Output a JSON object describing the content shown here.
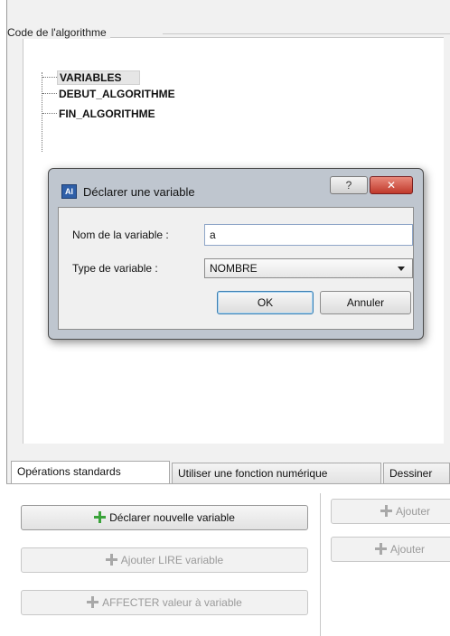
{
  "code_group": {
    "legend": "Code de l'algorithme",
    "tree": [
      "VARIABLES",
      "DEBUT_ALGORITHME",
      "FIN_ALGORITHME"
    ]
  },
  "dialog": {
    "title": "Déclarer une variable",
    "icon_text": "AI",
    "help_glyph": "?",
    "close_glyph": "✕",
    "name_label": "Nom de la variable :",
    "name_value": "a",
    "type_label": "Type de variable :",
    "type_value": "NOMBRE",
    "ok_label": "OK",
    "cancel_label": "Annuler"
  },
  "tabs": [
    {
      "label": "Opérations standards",
      "active": true
    },
    {
      "label": "Utiliser une fonction numérique",
      "active": false
    },
    {
      "label": "Dessiner",
      "active": false
    }
  ],
  "operations": {
    "declare": "Déclarer nouvelle variable",
    "read": "Ajouter LIRE variable",
    "assign": "AFFECTER valeur à variable",
    "right_1": "Ajouter",
    "right_2": "Ajouter"
  },
  "colors": {
    "accent_plus": "#3aa33a",
    "close_button": "#c0392b"
  }
}
